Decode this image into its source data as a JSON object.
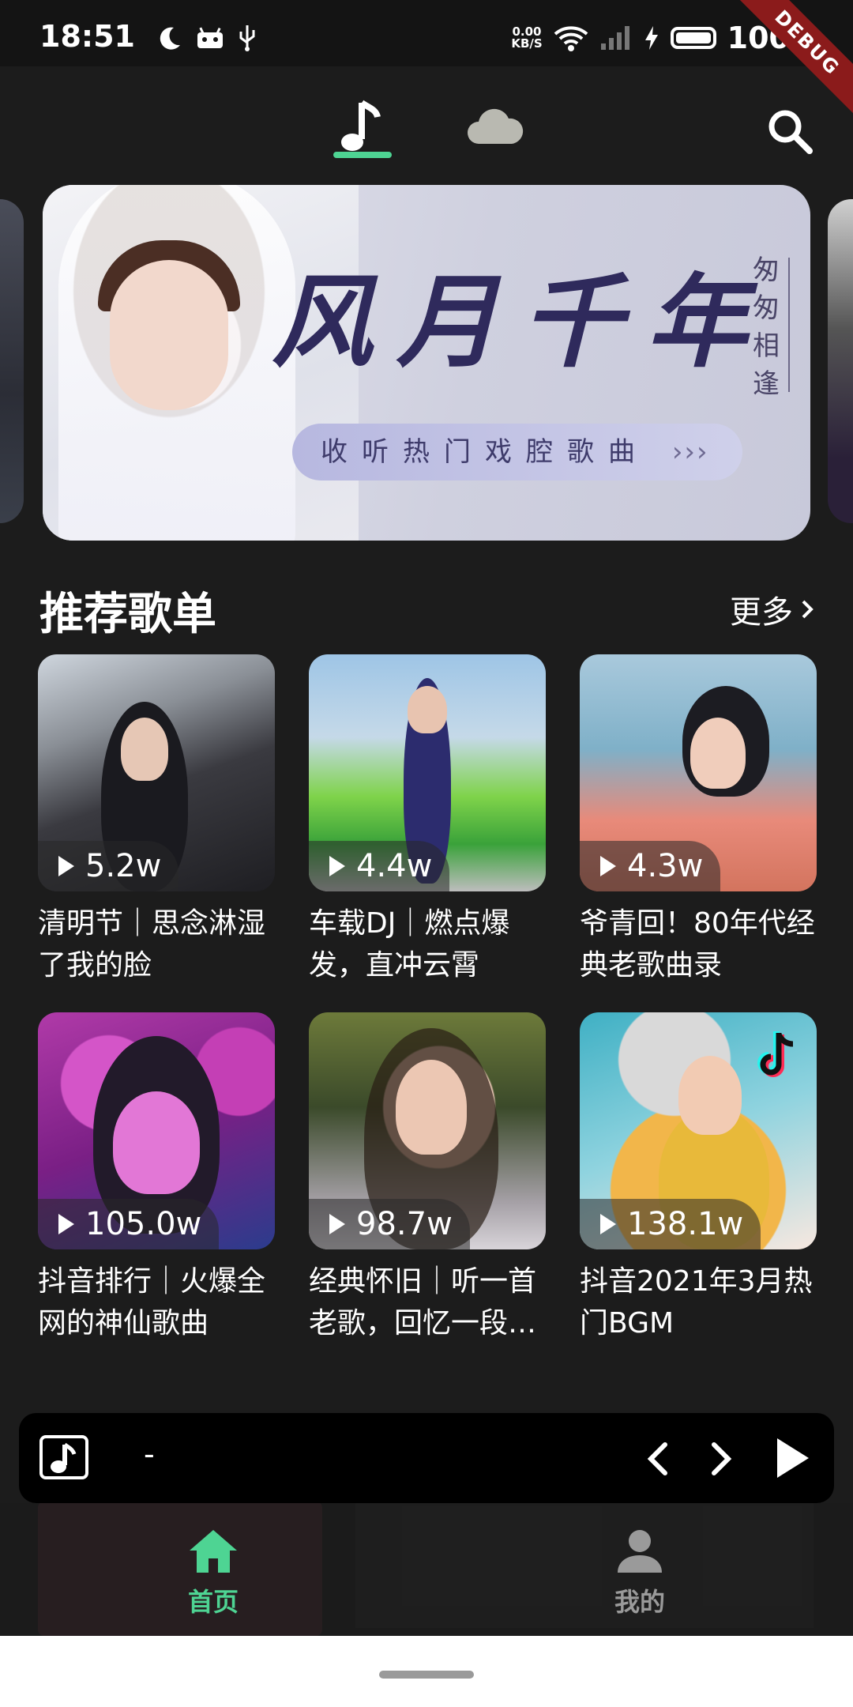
{
  "status_bar": {
    "time": "18:51",
    "net_speed_value": "0.00",
    "net_speed_unit": "KB/S",
    "battery_percent": "100",
    "debug_label": "DEBUG",
    "icons": [
      "moon-icon",
      "android-icon",
      "usb-icon",
      "wifi-icon",
      "signal-icon",
      "charging-icon",
      "battery-icon"
    ]
  },
  "top_nav": {
    "tabs": [
      {
        "icon": "music-note-icon",
        "selected": true
      },
      {
        "icon": "cloud-icon",
        "selected": false
      }
    ],
    "search_icon": "search-icon",
    "accent_color": "#4ed493"
  },
  "banner": {
    "title": "风月千年",
    "side_text": [
      "匆",
      "匆",
      "相",
      "逢"
    ],
    "pill_text": "收听热门戏腔歌曲",
    "pill_arrows": "›››"
  },
  "recommend": {
    "title": "推荐歌单",
    "more_label": "更多",
    "playlists": [
      {
        "count": "5.2w",
        "title": "清明节｜思念淋湿了我的脸"
      },
      {
        "count": "4.4w",
        "title": "车载DJ｜燃点爆发，直冲云霄"
      },
      {
        "count": "4.3w",
        "title": "爷青回！80年代经典老歌曲录"
      },
      {
        "count": "105.0w",
        "title": "抖音排行｜火爆全网的神仙歌曲"
      },
      {
        "count": "98.7w",
        "title": "经典怀旧｜听一首老歌，回忆一段…"
      },
      {
        "count": "138.1w",
        "title": "抖音2021年3月热门BGM"
      }
    ]
  },
  "player": {
    "song": "-",
    "icons": [
      "music-note-icon",
      "prev-icon",
      "next-icon",
      "play-icon"
    ]
  },
  "bottom_nav": {
    "items": [
      {
        "label": "首页",
        "icon": "home-icon",
        "active": true
      },
      {
        "label": "我的",
        "icon": "person-icon",
        "active": false
      }
    ]
  }
}
